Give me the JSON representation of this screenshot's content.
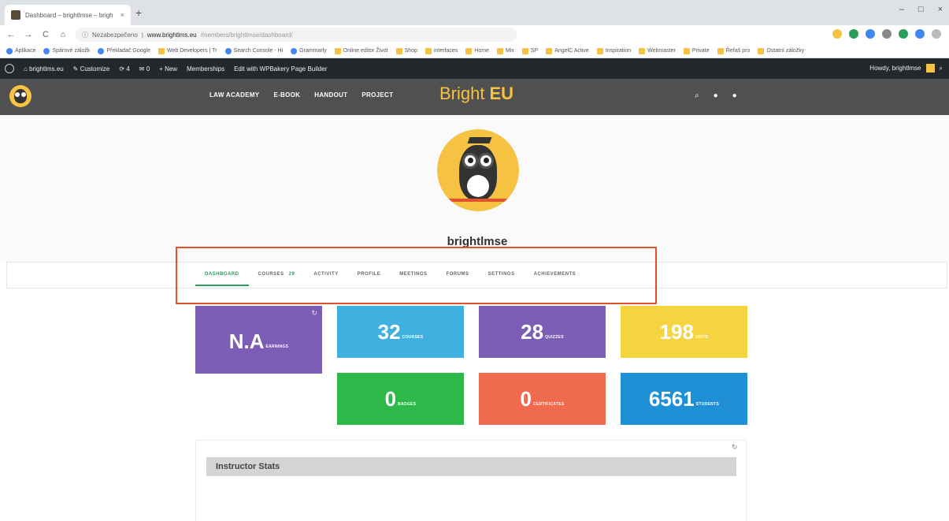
{
  "browser": {
    "tab_title": "Dashboard – brightlmse – brigh",
    "tab_close": "×",
    "new_tab": "+",
    "window_controls": [
      "–",
      "□",
      "×"
    ],
    "nav": {
      "back": "←",
      "forward": "→",
      "reload": "C",
      "home": "⌂"
    },
    "security_label": "Nezabezpečeno",
    "url_host": "www.brightlms.eu",
    "url_path": "/members/brightlmse/dashboard/",
    "extension_colors": [
      "#f5c242",
      "#2a9d5c",
      "#4285f4",
      "#888888",
      "#2a9d5c",
      "#4285f4",
      "#bbbbbb"
    ]
  },
  "bookmarks": {
    "items": [
      {
        "label": "Aplikace",
        "icon": "apps-icon"
      },
      {
        "label": "Spárové záložk",
        "icon": "bookmark-icon"
      },
      {
        "label": "Překladač Google",
        "icon": "translate-icon"
      },
      {
        "label": "Web Developers | Tr",
        "icon": "folder-icon"
      },
      {
        "label": "Search Console - Hi",
        "icon": "google-icon"
      },
      {
        "label": "Grammarly",
        "icon": "grammarly-icon"
      },
      {
        "label": "Online editor Život",
        "icon": "folder-icon"
      },
      {
        "label": "Shop",
        "icon": "folder-icon"
      },
      {
        "label": "interfaces",
        "icon": "folder-icon"
      },
      {
        "label": "Home",
        "icon": "folder-icon"
      },
      {
        "label": "Mix",
        "icon": "folder-icon"
      },
      {
        "label": "SP",
        "icon": "folder-icon"
      },
      {
        "label": "AngelC Active",
        "icon": "folder-icon"
      },
      {
        "label": "Inspiration",
        "icon": "folder-icon"
      },
      {
        "label": "Webmaster",
        "icon": "folder-icon"
      },
      {
        "label": "Private",
        "icon": "folder-icon"
      },
      {
        "label": "Řeřaš pro",
        "icon": "folder-icon"
      },
      {
        "label": "Ostatní záložky",
        "icon": "folder-icon"
      }
    ]
  },
  "wpbar": {
    "site": "brightlms.eu",
    "customize": "Customize",
    "updates": "4",
    "comments": "0",
    "new": "New",
    "memberships": "Memberships",
    "builder": "Edit with WPBakery Page Builder",
    "howdy": "Howdy, brightlmse"
  },
  "site": {
    "nav": [
      "LAW ACADEMY",
      "E-BOOK",
      "HANDOUT",
      "PROJECT"
    ],
    "brand_part1": "Bright",
    "brand_part2": "EU",
    "head_icons": [
      "search-icon",
      "user-icon",
      "cart-icon"
    ],
    "brand_color": "#f5c242"
  },
  "profile": {
    "username": "brightlmse",
    "tabs": [
      {
        "label": "DASHBOARD",
        "active": true
      },
      {
        "label": "COURSES",
        "count": "29"
      },
      {
        "label": "ACTIVITY"
      },
      {
        "label": "PROFILE"
      },
      {
        "label": "MEETINGS"
      },
      {
        "label": "FORUMS"
      },
      {
        "label": "SETTINGS"
      },
      {
        "label": "ACHIEVEMENTS"
      }
    ],
    "accent_color": "#2a9d5c",
    "highlight_color": "#e4522d"
  },
  "stats": [
    {
      "value": "N.A",
      "label": "EARNINGS",
      "color": "#7b5db5"
    },
    {
      "value": "32",
      "label": "COURSES",
      "color": "#3fb0e0"
    },
    {
      "value": "28",
      "label": "QUIZZES",
      "color": "#7b5db5"
    },
    {
      "value": "198",
      "label": "UNITS",
      "color": "#f5d53f"
    },
    {
      "value": "0",
      "label": "BADGES",
      "color": "#2fb84a"
    },
    {
      "value": "0",
      "label": "CERTIFICATES",
      "color": "#f06a4f"
    },
    {
      "value": "6561",
      "label": "STUDENTS",
      "color": "#1f8fd6"
    }
  ],
  "instructor": {
    "title": "Instructor Stats",
    "refresh": "↻"
  }
}
